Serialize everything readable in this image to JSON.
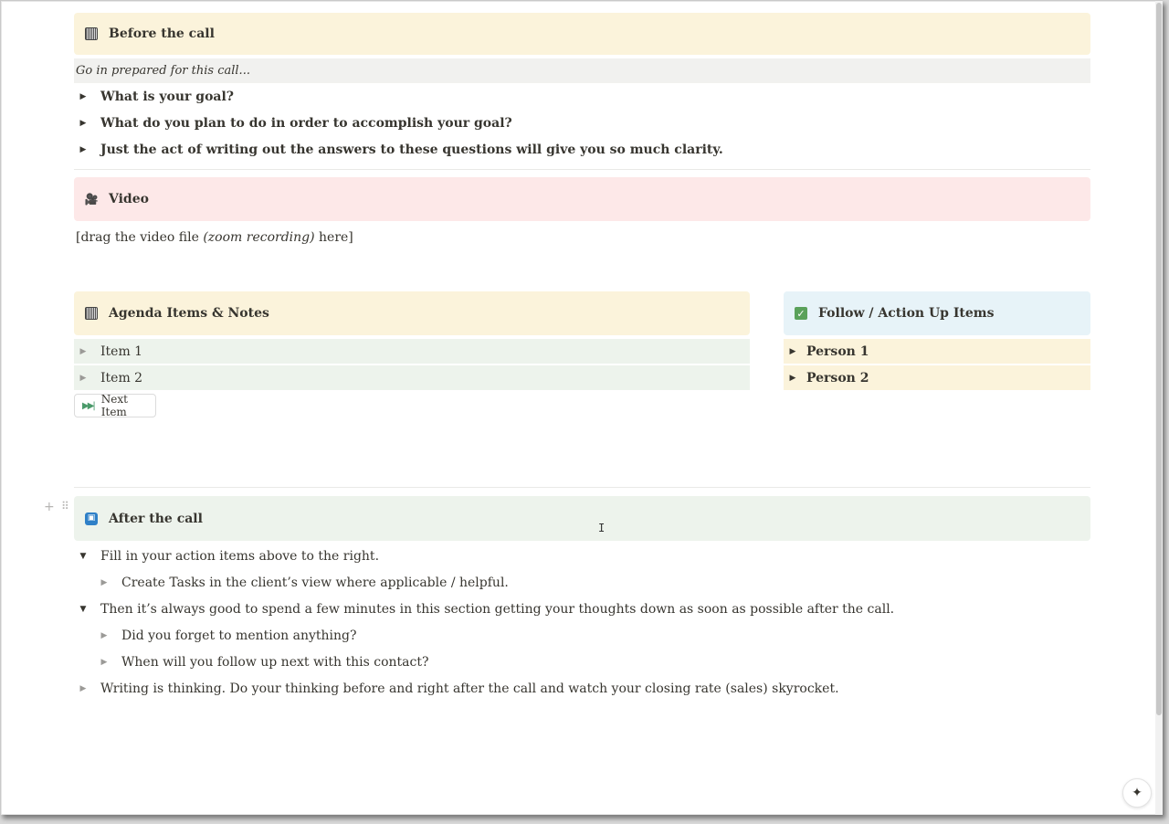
{
  "before_call": {
    "title": "Before the call",
    "intro": "Go in prepared for this call...",
    "questions": [
      "What is your goal?",
      "What do you plan to do in order to accomplish your goal?",
      "Just the act of writing out the answers to these questions will give you so much clarity."
    ]
  },
  "video": {
    "title": "Video",
    "text_before": "[drag the video file ",
    "text_italic": "(zoom recording)",
    "text_after": " here]"
  },
  "agenda": {
    "title": "Agenda Items & Notes",
    "items": [
      "Item 1",
      "Item 2"
    ],
    "next_button": "Next Item"
  },
  "follow_up": {
    "title": "Follow / Action Up Items",
    "people": [
      "Person 1",
      "Person 2"
    ]
  },
  "after_call": {
    "title": "After the call",
    "item1": "Fill in your action items above to the right.",
    "item1_sub": "Create Tasks in the client’s view where applicable / helpful.",
    "item2": "Then it’s always good to spend a few minutes in this section getting your thoughts down as soon as possible after the call.",
    "item2_subs": [
      "Did you forget to mention anything?",
      "When will you follow up next with this contact?"
    ],
    "item3": "Writing is thinking. Do your thinking before and right after the call and watch your closing rate (sales) skyrocket."
  },
  "colors": {
    "yellow_callout": "#fbf3db",
    "pink_callout": "#fde8e8",
    "blue_callout": "#e7f3f8",
    "green_callout": "#edf3ec",
    "check_green": "#5aa15a",
    "calendar_blue": "#2f80c7"
  },
  "icons": {
    "before_call": "notebook-icon",
    "video": "film-camera-icon",
    "agenda": "notebook-icon",
    "follow_up": "check-box-icon",
    "after_call": "calendar-icon",
    "next_button": "fast-forward-icon",
    "ai": "sparkle-icon"
  }
}
